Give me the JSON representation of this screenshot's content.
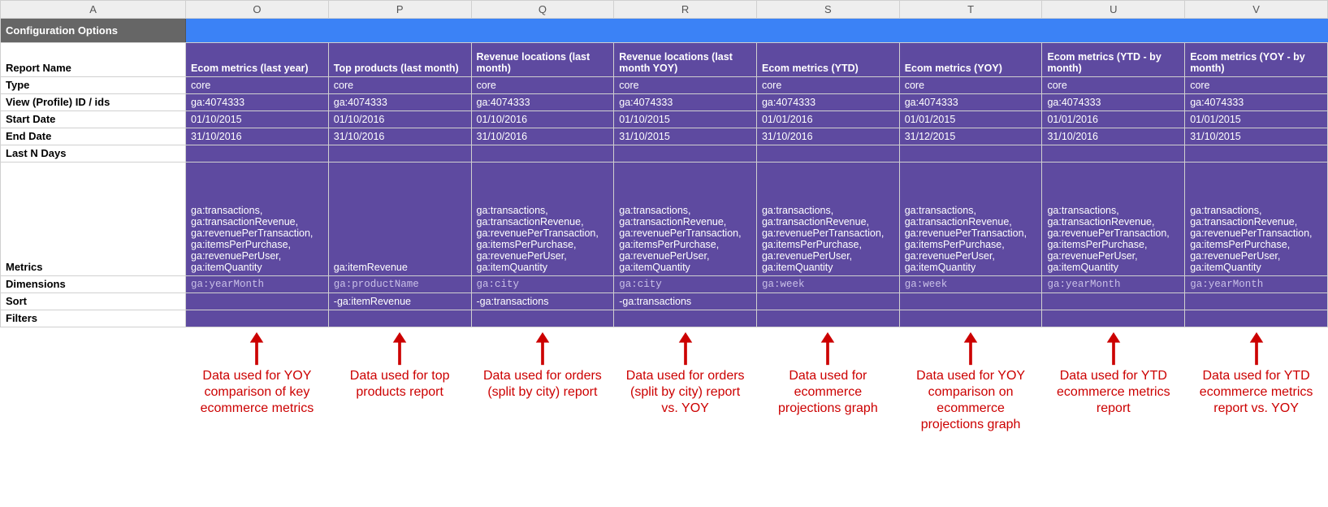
{
  "cols": [
    "A",
    "O",
    "P",
    "Q",
    "R",
    "S",
    "T",
    "U",
    "V"
  ],
  "title": "Configuration Options",
  "rows": [
    {
      "label": "Report Name",
      "cells": [
        "Ecom metrics (last year)",
        "Top products (last month)",
        "Revenue locations (last month)",
        "Revenue locations (last month YOY)",
        "Ecom metrics (YTD)",
        "Ecom metrics (YOY)",
        "Ecom metrics (YTD - by month)",
        "Ecom metrics (YOY - by month)"
      ],
      "header": true
    },
    {
      "label": "Type",
      "cells": [
        "core",
        "core",
        "core",
        "core",
        "core",
        "core",
        "core",
        "core"
      ]
    },
    {
      "label": "View (Profile) ID / ids",
      "cells": [
        "ga:4074333",
        "ga:4074333",
        "ga:4074333",
        "ga:4074333",
        "ga:4074333",
        "ga:4074333",
        "ga:4074333",
        "ga:4074333"
      ]
    },
    {
      "label": "Start Date",
      "cells": [
        "01/10/2015",
        "01/10/2016",
        "01/10/2016",
        "01/10/2015",
        "01/01/2016",
        "01/01/2015",
        "01/01/2016",
        "01/01/2015"
      ]
    },
    {
      "label": "End Date",
      "cells": [
        "31/10/2016",
        "31/10/2016",
        "31/10/2016",
        "31/10/2015",
        "31/10/2016",
        "31/12/2015",
        "31/10/2016",
        "31/10/2015"
      ]
    },
    {
      "label": "Last N Days",
      "cells": [
        "",
        "",
        "",
        "",
        "",
        "",
        "",
        ""
      ]
    },
    {
      "label": "Metrics",
      "tall": true,
      "cells": [
        "ga:transactions, ga:transactionRevenue, ga:revenuePerTransaction, ga:itemsPerPurchase, ga:revenuePerUser, ga:itemQuantity",
        "ga:itemRevenue",
        "ga:transactions, ga:transactionRevenue, ga:revenuePerTransaction, ga:itemsPerPurchase, ga:revenuePerUser, ga:itemQuantity",
        "ga:transactions, ga:transactionRevenue, ga:revenuePerTransaction, ga:itemsPerPurchase, ga:revenuePerUser, ga:itemQuantity",
        "ga:transactions, ga:transactionRevenue, ga:revenuePerTransaction, ga:itemsPerPurchase, ga:revenuePerUser, ga:itemQuantity",
        "ga:transactions, ga:transactionRevenue, ga:revenuePerTransaction, ga:itemsPerPurchase, ga:revenuePerUser, ga:itemQuantity",
        "ga:transactions, ga:transactionRevenue, ga:revenuePerTransaction, ga:itemsPerPurchase, ga:revenuePerUser, ga:itemQuantity",
        "ga:transactions, ga:transactionRevenue, ga:revenuePerTransaction, ga:itemsPerPurchase, ga:revenuePerUser, ga:itemQuantity"
      ]
    },
    {
      "label": "Dimensions",
      "dim": true,
      "cells": [
        "ga:yearMonth",
        "ga:productName",
        "ga:city",
        "ga:city",
        "ga:week",
        "ga:week",
        "ga:yearMonth",
        "ga:yearMonth"
      ]
    },
    {
      "label": "Sort",
      "cells": [
        "",
        "-ga:itemRevenue",
        "-ga:transactions",
        "-ga:transactions",
        "",
        "",
        "",
        ""
      ]
    },
    {
      "label": "Filters",
      "cells": [
        "",
        "",
        "",
        "",
        "",
        "",
        "",
        ""
      ]
    }
  ],
  "annotations": [
    "Data used for YOY comparison of key ecommerce metrics",
    "Data used for top products report",
    "Data used for orders (split by city) report",
    "Data used for orders (split by city) report vs. YOY",
    "Data used for ecommerce projections graph",
    "Data used for YOY comparison on ecommerce projections graph",
    "Data used for YTD ecommerce metrics report",
    "Data used for YTD ecommerce metrics report vs. YOY"
  ]
}
